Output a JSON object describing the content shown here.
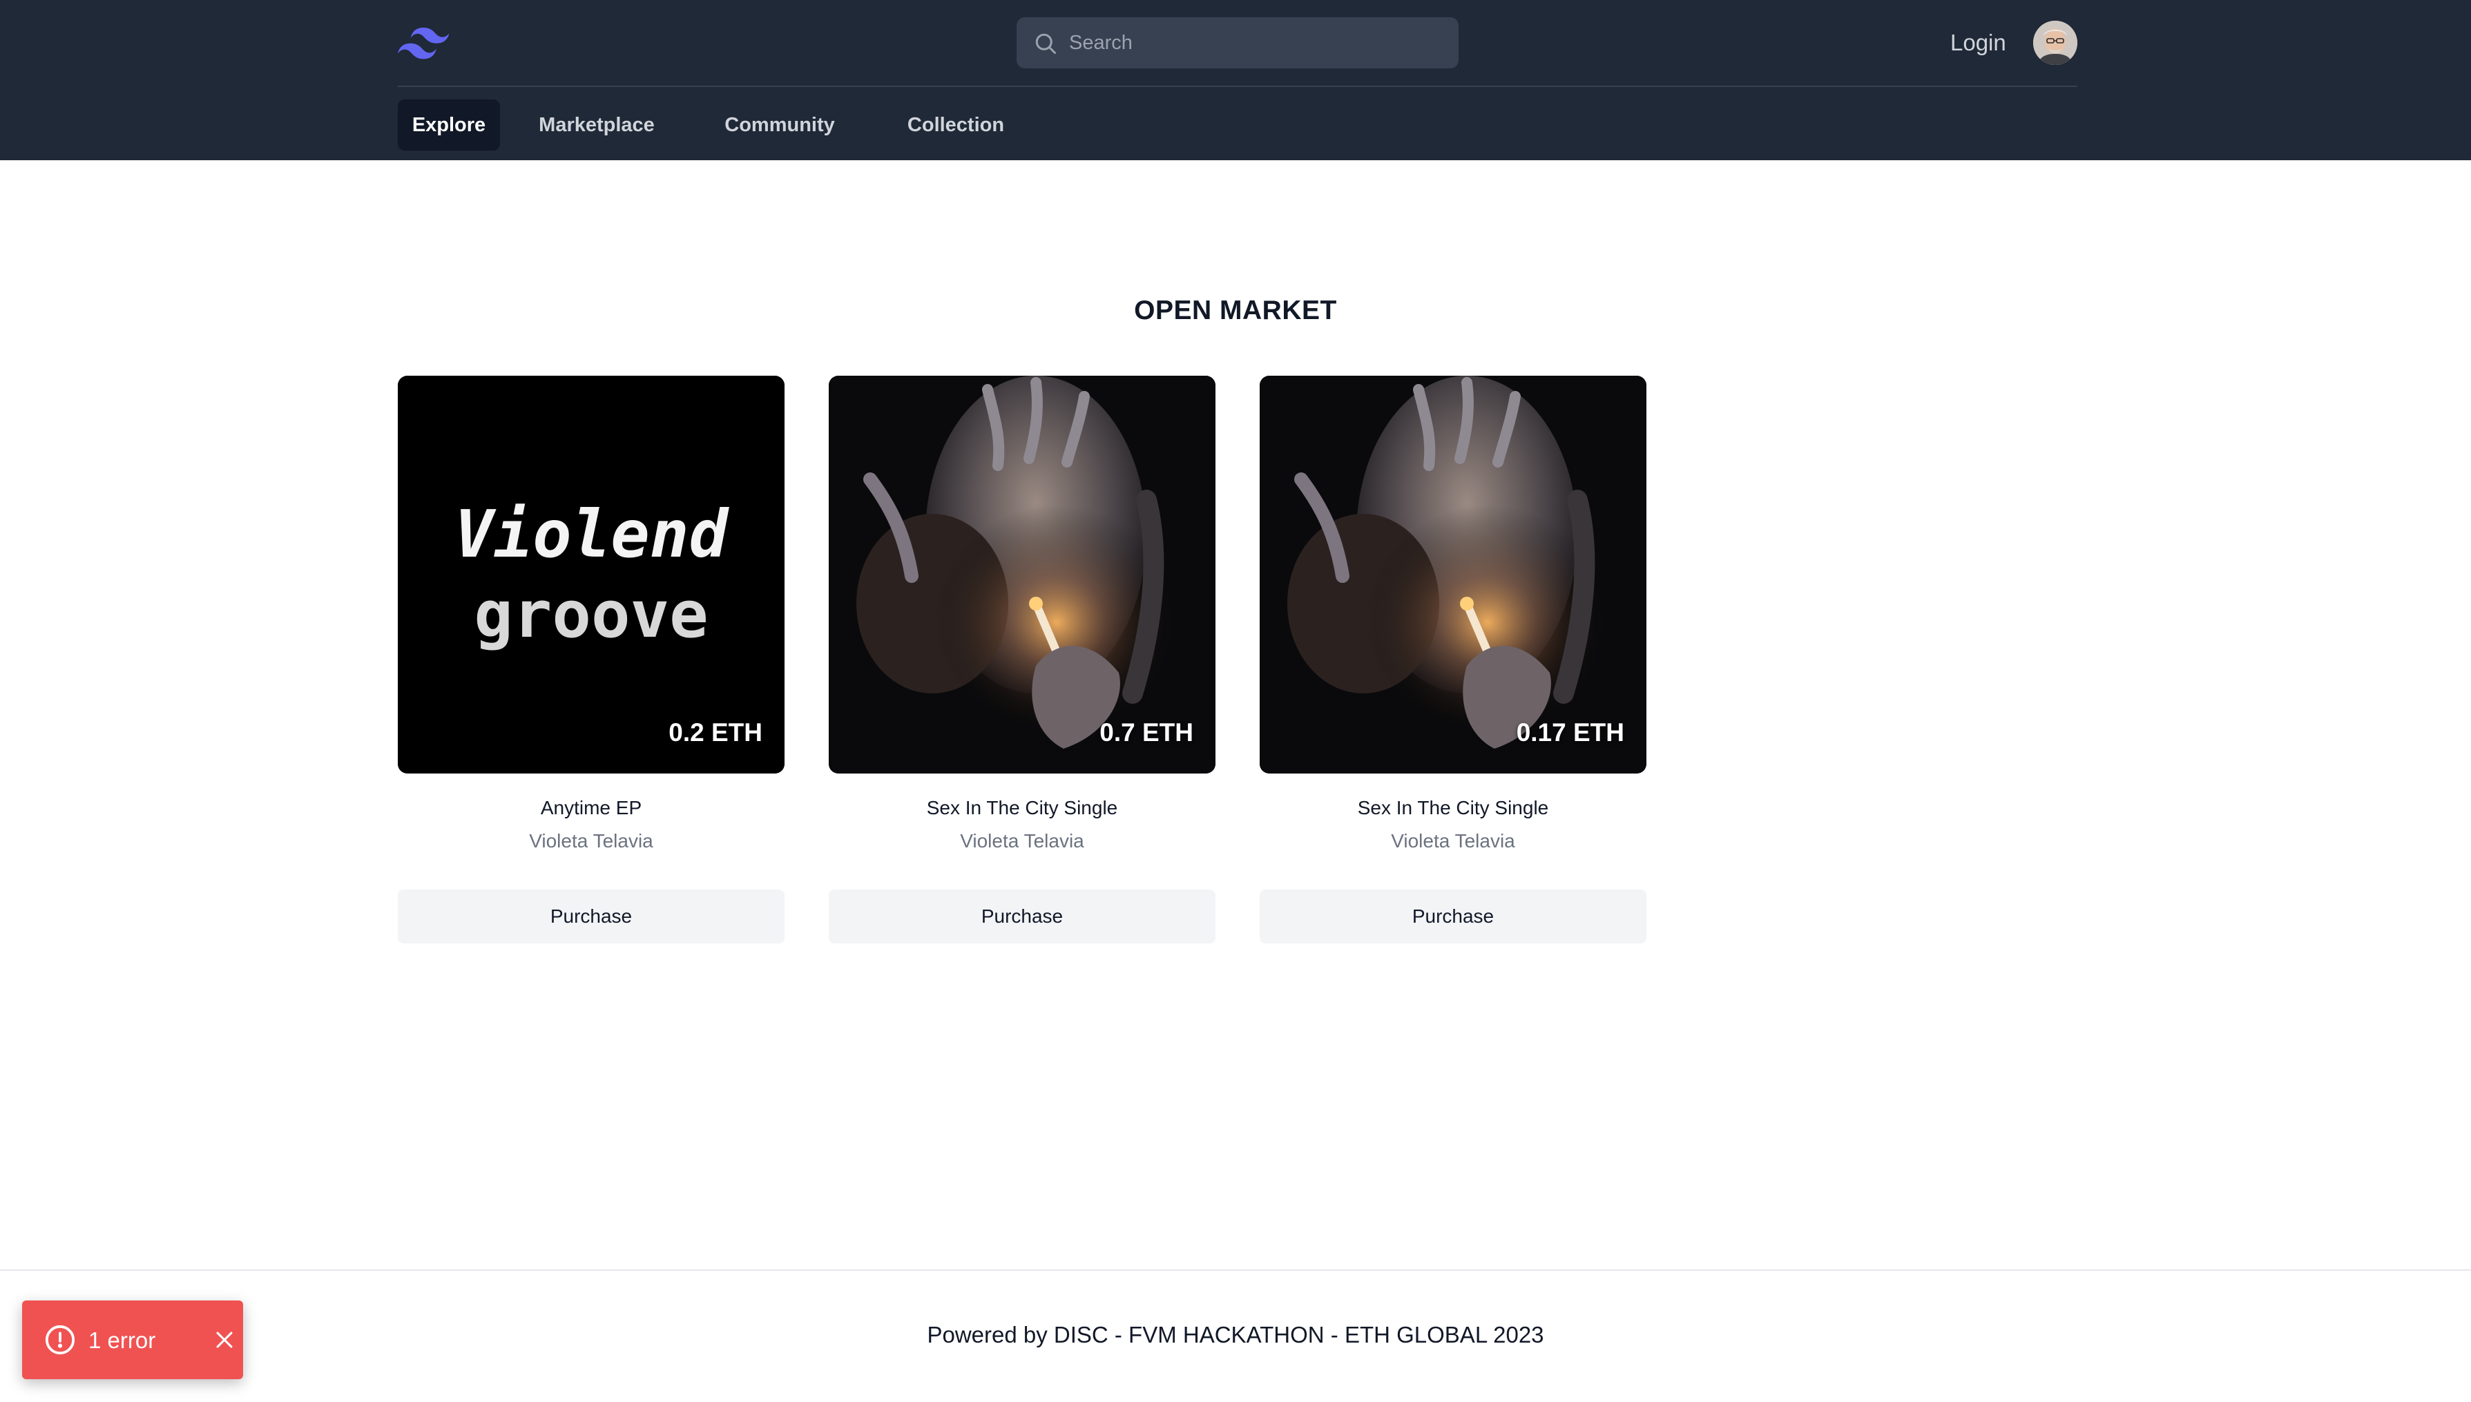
{
  "header": {
    "search": {
      "placeholder": "Search"
    },
    "login_label": "Login",
    "nav_tabs": [
      {
        "label": "Explore",
        "active": true
      },
      {
        "label": "Marketplace",
        "active": false
      },
      {
        "label": "Community",
        "active": false
      },
      {
        "label": "Collection",
        "active": false
      }
    ]
  },
  "main": {
    "title": "OPEN MARKET",
    "cards": [
      {
        "price": "0.2 ETH",
        "title": "Anytime EP",
        "artist": "Violeta Telavia",
        "button": "Purchase",
        "cover_text": [
          "Violend",
          "groove"
        ]
      },
      {
        "price": "0.7 ETH",
        "title": "Sex In The City Single",
        "artist": "Violeta Telavia",
        "button": "Purchase"
      },
      {
        "price": "0.17 ETH",
        "title": "Sex In The City Single",
        "artist": "Violeta Telavia",
        "button": "Purchase"
      }
    ]
  },
  "footer": {
    "text": "Powered by DISC - FVM HACKATHON - ETH GLOBAL 2023"
  },
  "error_toast": {
    "text": "1 error"
  },
  "icons": {
    "logo": "tailwind-logo-icon",
    "search": "search-icon",
    "error": "alert-circle-icon",
    "close": "close-icon"
  },
  "colors": {
    "header_bg": "#1f2937",
    "accent": "#6366f1",
    "error": "#f05252"
  }
}
